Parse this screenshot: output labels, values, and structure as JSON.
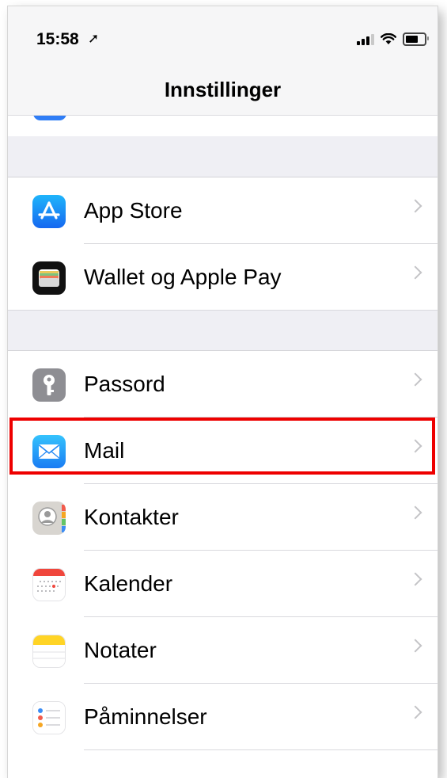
{
  "status_bar": {
    "time": "15:58",
    "location_glyph": "➚"
  },
  "navigation": {
    "title": "Innstillinger"
  },
  "groups": [
    {
      "items": [
        {
          "id": "app-store",
          "label": "App Store",
          "icon": "app-store-icon"
        },
        {
          "id": "wallet",
          "label": "Wallet og Apple Pay",
          "icon": "wallet-icon"
        }
      ]
    },
    {
      "items": [
        {
          "id": "passwords",
          "label": "Passord",
          "icon": "key-icon"
        },
        {
          "id": "mail",
          "label": "Mail",
          "icon": "mail-icon",
          "highlighted": true
        },
        {
          "id": "contacts",
          "label": "Kontakter",
          "icon": "contacts-icon"
        },
        {
          "id": "calendar",
          "label": "Kalender",
          "icon": "calendar-icon"
        },
        {
          "id": "notes",
          "label": "Notater",
          "icon": "notes-icon"
        },
        {
          "id": "reminders",
          "label": "Påminnelser",
          "icon": "reminders-icon"
        }
      ]
    }
  ],
  "colors": {
    "highlight_border": "#ee0000",
    "app_store": "#1c8cf5",
    "mail": "#2d8ef6",
    "grouped_background": "#efeff4"
  }
}
